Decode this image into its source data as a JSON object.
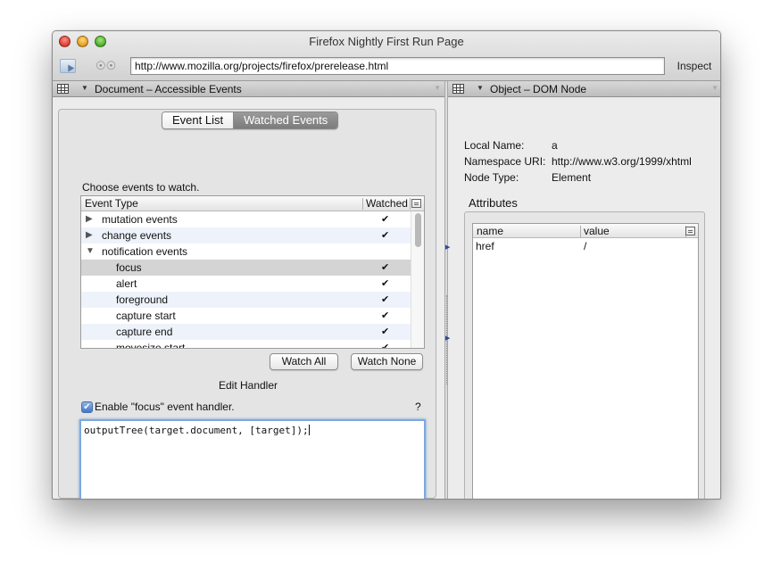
{
  "window": {
    "title": "Firefox Nightly First Run Page"
  },
  "toolbar": {
    "url": "http://www.mozilla.org/projects/firefox/prerelease.html",
    "inspect_label": "Inspect",
    "inspect_icon": "node-picker-icon",
    "find_icon": "binoculars-icon"
  },
  "left_panel": {
    "title": "Document – Accessible Events",
    "tabs": [
      {
        "label": "Event List",
        "selected": false
      },
      {
        "label": "Watched Events",
        "selected": true
      }
    ],
    "choose_label": "Choose events to watch.",
    "columns": {
      "event_type": "Event Type",
      "watched": "Watched"
    },
    "rows": [
      {
        "label": "mutation events",
        "twisty": "▶",
        "watched": "✔"
      },
      {
        "label": "change events",
        "twisty": "▶",
        "watched": "✔"
      },
      {
        "label": "notification events",
        "twisty": "▼",
        "watched": ""
      },
      {
        "label": "focus",
        "twisty": "",
        "watched": "✔"
      },
      {
        "label": "alert",
        "twisty": "",
        "watched": "✔"
      },
      {
        "label": "foreground",
        "twisty": "",
        "watched": "✔"
      },
      {
        "label": "capture start",
        "twisty": "",
        "watched": "✔"
      },
      {
        "label": "capture end",
        "twisty": "",
        "watched": "✔"
      },
      {
        "label": "movesize start",
        "twisty": "",
        "watched": "✔"
      }
    ],
    "watch_all": "Watch All",
    "watch_none": "Watch None",
    "edit_handler": "Edit Handler",
    "enable_handler": "Enable \"focus\" event handler.",
    "enable_checked": true,
    "help": "?",
    "handler_code": "outputTree(target.document, [target]);"
  },
  "right_panel": {
    "title": "Object – DOM Node",
    "local_name_label": "Local Name:",
    "local_name": "a",
    "namespace_label": "Namespace URI:",
    "namespace": "http://www.w3.org/1999/xhtml",
    "node_type_label": "Node Type:",
    "node_type": "Element",
    "attributes_title": "Attributes",
    "attr_columns": {
      "name": "name",
      "value": "value"
    },
    "attributes": [
      {
        "name": "href",
        "value": "/"
      }
    ]
  }
}
